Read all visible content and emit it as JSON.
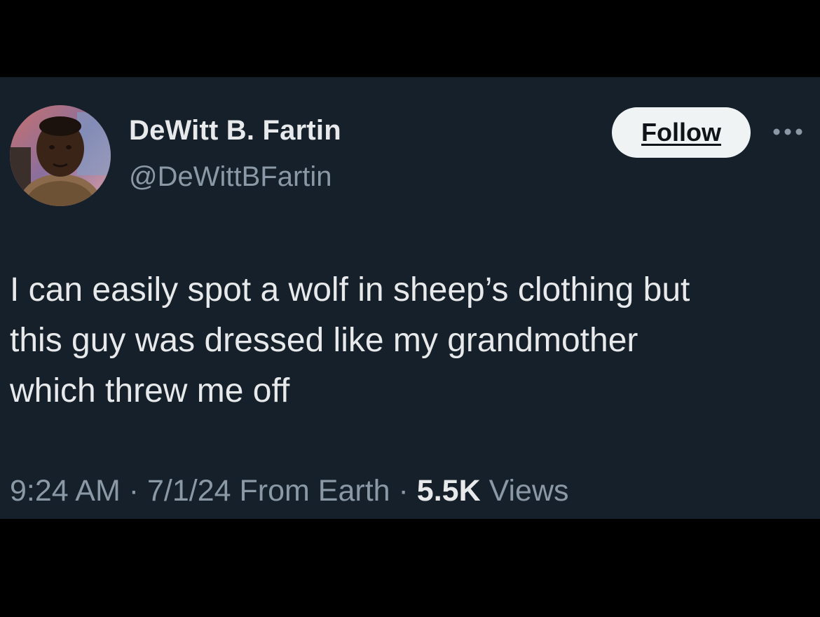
{
  "user": {
    "display_name": "DeWitt B. Fartin",
    "handle": "@DeWittBFartin",
    "avatar_icon": "profile-photo"
  },
  "actions": {
    "follow_label": "Follow",
    "more_icon": "ellipsis-icon"
  },
  "tweet": {
    "text_lines": [
      "I can easily spot a wolf in sheep’s clothing but",
      "this guy was dressed like my grandmother",
      "which threw me off"
    ]
  },
  "meta": {
    "time": "9:24 AM",
    "separator": "·",
    "date": "7/1/24",
    "source": "From Earth",
    "views_count": "5.5K",
    "views_label": "Views"
  },
  "colors": {
    "page_background": "#000000",
    "card_background": "#15202b",
    "primary_text": "#e7e9ea",
    "secondary_text": "#8b98a5",
    "follow_button_bg": "#eff3f4",
    "follow_button_text": "#0f1419"
  }
}
